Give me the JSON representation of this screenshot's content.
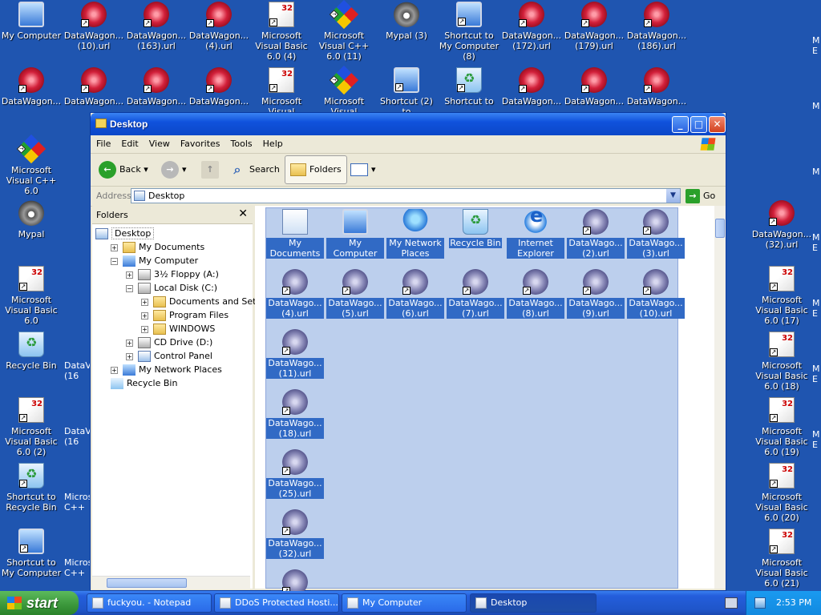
{
  "desktop": {
    "row1": [
      {
        "label": "My Computer",
        "icon": "computer-icon"
      },
      {
        "label": "DataWagon... (10).url",
        "icon": "url-icon"
      },
      {
        "label": "DataWagon... (163).url",
        "icon": "url-icon"
      },
      {
        "label": "DataWagon... (4).url",
        "icon": "url-icon"
      },
      {
        "label": "Microsoft Visual Basic 6.0 (4)",
        "icon": "vb6-icon"
      },
      {
        "label": "Microsoft Visual C++ 6.0 (11)",
        "icon": "vc6-icon"
      },
      {
        "label": "Mypal (3)",
        "icon": "mypal-icon"
      },
      {
        "label": "Shortcut to My Computer (8)",
        "icon": "computer-icon"
      },
      {
        "label": "DataWagon... (172).url",
        "icon": "url-icon"
      },
      {
        "label": "DataWagon... (179).url",
        "icon": "url-icon"
      },
      {
        "label": "DataWagon... (186).url",
        "icon": "url-icon"
      }
    ],
    "row2": [
      {
        "label": "DataWagon...",
        "icon": "url-icon"
      },
      {
        "label": "DataWagon...",
        "icon": "url-icon"
      },
      {
        "label": "DataWagon...",
        "icon": "url-icon"
      },
      {
        "label": "DataWagon...",
        "icon": "url-icon"
      },
      {
        "label": "Microsoft Visual",
        "icon": "vb6-icon"
      },
      {
        "label": "Microsoft Visual",
        "icon": "vc6-icon"
      },
      {
        "label": "Shortcut (2) to",
        "icon": "computer-icon"
      },
      {
        "label": "Shortcut to",
        "icon": "recycle-bin-icon"
      },
      {
        "label": "DataWagon...",
        "icon": "url-icon"
      },
      {
        "label": "DataWagon...",
        "icon": "url-icon"
      },
      {
        "label": "DataWagon...",
        "icon": "url-icon"
      }
    ],
    "left_column": [
      {
        "label": "Microsoft Visual C++ 6.0",
        "icon": "vc6-icon"
      },
      {
        "label": "Mypal",
        "icon": "mypal-icon"
      },
      {
        "label": "Microsoft Visual Basic 6.0",
        "icon": "vb6-icon"
      },
      {
        "label": "Recycle Bin",
        "icon": "recycle-bin-icon"
      },
      {
        "label": "Microsoft Visual Basic 6.0 (2)",
        "icon": "vb6-icon"
      },
      {
        "label": "Shortcut to Recycle Bin",
        "icon": "recycle-bin-icon"
      },
      {
        "label": "Shortcut to My Computer",
        "icon": "computer-icon"
      }
    ],
    "right_column": [
      {
        "label": "DataWagon... (32).url",
        "icon": "url-icon"
      },
      {
        "label": "Microsoft Visual Basic 6.0 (17)",
        "icon": "vb6-icon"
      },
      {
        "label": "Microsoft Visual Basic 6.0 (18)",
        "icon": "vb6-icon"
      },
      {
        "label": "Microsoft Visual Basic 6.0 (19)",
        "icon": "vb6-icon"
      },
      {
        "label": "Microsoft Visual Basic 6.0 (20)",
        "icon": "vb6-icon"
      },
      {
        "label": "Microsoft Visual Basic 6.0 (21)",
        "icon": "vb6-icon"
      }
    ],
    "partial_left": [
      "DataV (16",
      "DataV (16",
      "Micros C++",
      "Micros C++"
    ],
    "partial_right": [
      "M E",
      "M",
      "M",
      "M E",
      "M E",
      "M E",
      "M E"
    ]
  },
  "window": {
    "title": "Desktop",
    "menu": [
      "File",
      "Edit",
      "View",
      "Favorites",
      "Tools",
      "Help"
    ],
    "toolbar": {
      "back": "Back",
      "search": "Search",
      "folders": "Folders"
    },
    "address_label": "Address",
    "address_value": "Desktop",
    "go_label": "Go",
    "folders_title": "Folders",
    "tree": [
      {
        "label": "Desktop",
        "depth": 0,
        "expander": "",
        "icon": "desktop-icon",
        "selected": true
      },
      {
        "label": "My Documents",
        "depth": 1,
        "expander": "+",
        "icon": "folder-icon"
      },
      {
        "label": "My Computer",
        "depth": 1,
        "expander": "−",
        "icon": "computer-icon"
      },
      {
        "label": "3½ Floppy (A:)",
        "depth": 2,
        "expander": "+",
        "icon": "floppy-icon"
      },
      {
        "label": "Local Disk (C:)",
        "depth": 2,
        "expander": "−",
        "icon": "disk-icon"
      },
      {
        "label": "Documents and Settings",
        "depth": 3,
        "expander": "+",
        "icon": "folder-icon"
      },
      {
        "label": "Program Files",
        "depth": 3,
        "expander": "+",
        "icon": "folder-icon"
      },
      {
        "label": "WINDOWS",
        "depth": 3,
        "expander": "+",
        "icon": "folder-icon"
      },
      {
        "label": "CD Drive (D:)",
        "depth": 2,
        "expander": "+",
        "icon": "cd-drive-icon"
      },
      {
        "label": "Control Panel",
        "depth": 2,
        "expander": "+",
        "icon": "control-panel-icon"
      },
      {
        "label": "My Network Places",
        "depth": 1,
        "expander": "+",
        "icon": "network-icon"
      },
      {
        "label": "Recycle Bin",
        "depth": 1,
        "expander": "",
        "icon": "recycle-bin-icon"
      }
    ],
    "content_items": [
      {
        "label": "My Documents",
        "icon": "my-documents-icon"
      },
      {
        "label": "My Computer",
        "icon": "computer-icon"
      },
      {
        "label": "My Network Places",
        "icon": "network-icon"
      },
      {
        "label": "Recycle Bin",
        "icon": "recycle-bin-icon"
      },
      {
        "label": "Internet Explorer",
        "icon": "internet-explorer-icon"
      },
      {
        "label": "DataWago... (2).url",
        "icon": "url-icon"
      },
      {
        "label": "DataWago... (3).url",
        "icon": "url-icon"
      },
      {
        "label": "DataWago... (4).url",
        "icon": "url-icon"
      },
      {
        "label": "DataWago... (5).url",
        "icon": "url-icon"
      },
      {
        "label": "DataWago... (6).url",
        "icon": "url-icon"
      },
      {
        "label": "DataWago... (7).url",
        "icon": "url-icon"
      },
      {
        "label": "DataWago... (8).url",
        "icon": "url-icon"
      },
      {
        "label": "DataWago... (9).url",
        "icon": "url-icon"
      },
      {
        "label": "DataWago... (10).url",
        "icon": "url-icon"
      },
      {
        "label": "DataWago... (11).url",
        "icon": "url-icon"
      },
      {
        "label": "DataWago... (18).url",
        "icon": "url-icon"
      },
      {
        "label": "DataWago... (25).url",
        "icon": "url-icon"
      },
      {
        "label": "DataWago... (32).url",
        "icon": "url-icon"
      },
      {
        "label": "",
        "icon": "url-icon"
      }
    ]
  },
  "taskbar": {
    "start_label": "start",
    "tasks": [
      {
        "label": "fuckyou. - Notepad",
        "icon": "notepad-icon",
        "active": false
      },
      {
        "label": "DDoS Protected Hosti...",
        "icon": "mypal-icon",
        "active": false
      },
      {
        "label": "My Computer",
        "icon": "computer-icon",
        "active": false
      },
      {
        "label": "Desktop",
        "icon": "folder-icon",
        "active": true
      }
    ],
    "clock": "2:53 PM"
  },
  "colors": {
    "desktop_bg": "#1f55b0",
    "selection": "#316ac5",
    "title_bar": "#0b47c8"
  }
}
